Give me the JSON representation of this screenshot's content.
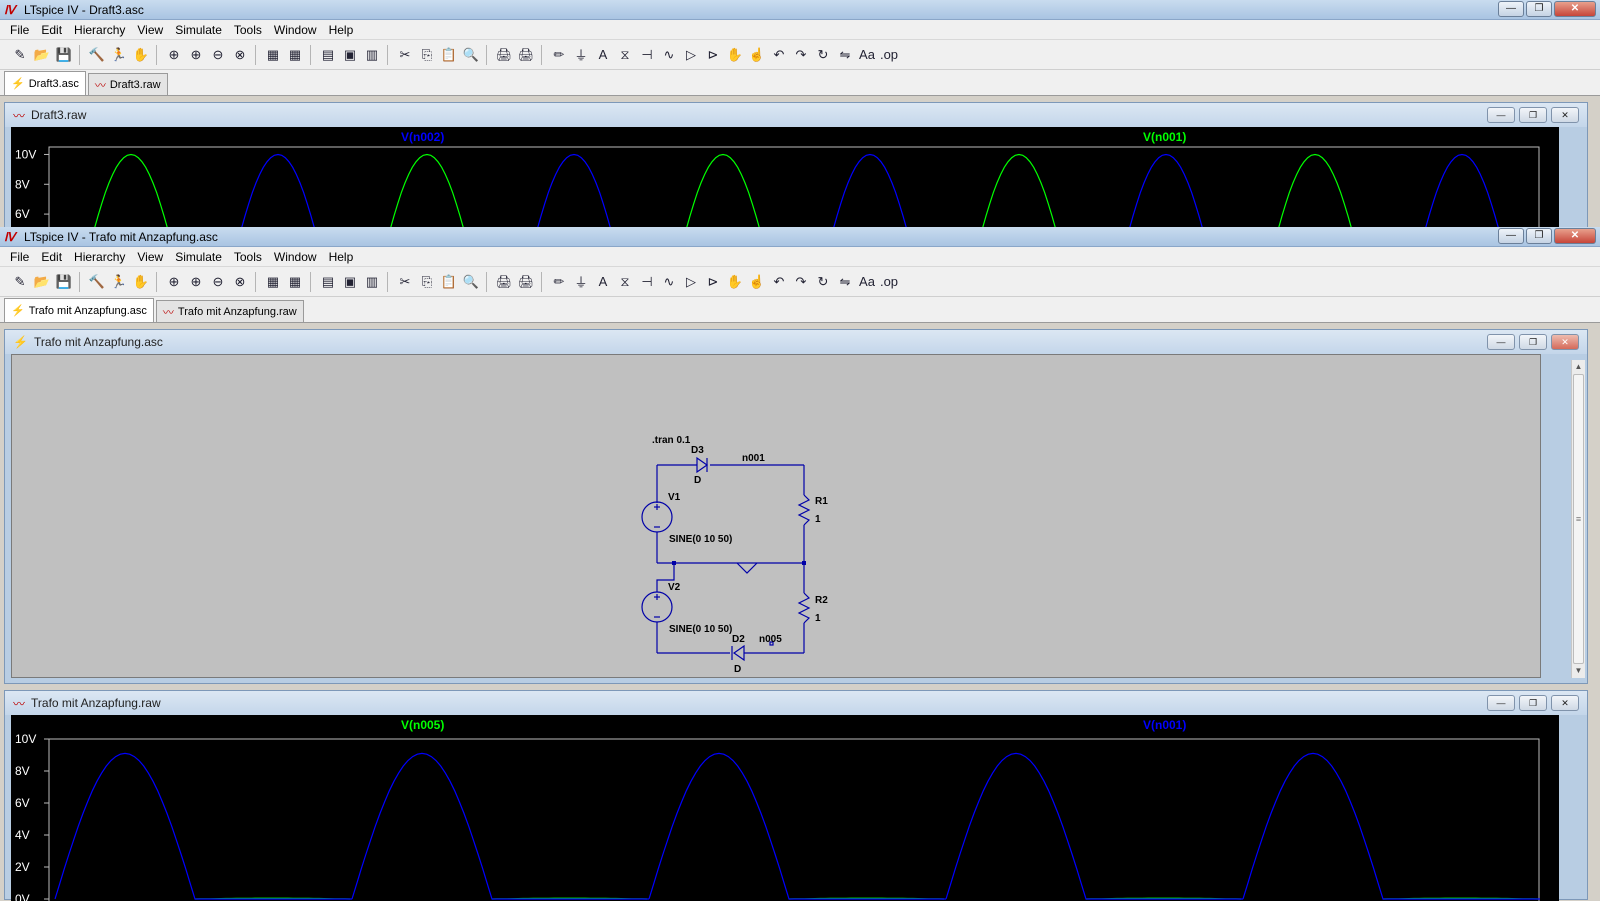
{
  "app1": {
    "title": "LTspice IV - Draft3.asc",
    "menu": [
      "File",
      "Edit",
      "Hierarchy",
      "View",
      "Simulate",
      "Tools",
      "Window",
      "Help"
    ],
    "tabs": [
      {
        "label": "Draft3.asc",
        "icon": "schematic-icon",
        "active": true
      },
      {
        "label": "Draft3.raw",
        "icon": "waveform-icon",
        "active": false
      }
    ],
    "plot_window": {
      "title": "Draft3.raw",
      "trace_labels": [
        {
          "label": "V(n002)",
          "color": "#0000ff"
        },
        {
          "label": "V(n001)",
          "color": "#00ff00"
        }
      ],
      "y_ticks": [
        "10V",
        "8V",
        "6V"
      ]
    }
  },
  "app2": {
    "title": "LTspice IV - Trafo mit Anzapfung.asc",
    "menu": [
      "File",
      "Edit",
      "Hierarchy",
      "View",
      "Simulate",
      "Tools",
      "Window",
      "Help"
    ],
    "tabs": [
      {
        "label": "Trafo mit Anzapfung.asc",
        "icon": "schematic-icon",
        "active": true
      },
      {
        "label": "Trafo mit Anzapfung.raw",
        "icon": "waveform-icon",
        "active": false
      }
    ],
    "schematic_window": {
      "title": "Trafo mit Anzapfung.asc",
      "directive": ".tran 0.1",
      "labels": {
        "d3": "D3",
        "d3_model": "D",
        "n001": "n001",
        "v1": "V1",
        "v1_value": "SINE(0 10 50)",
        "r1": "R1",
        "r1_value": "1",
        "v2": "V2",
        "v2_value": "SINE(0 10 50)",
        "r2": "R2",
        "r2_value": "1",
        "d2": "D2",
        "d2_model": "D",
        "n005": "n005"
      }
    },
    "plot_window": {
      "title": "Trafo mit Anzapfung.raw",
      "trace_labels": [
        {
          "label": "V(n005)",
          "color": "#00ff00"
        },
        {
          "label": "V(n001)",
          "color": "#0000ff"
        }
      ],
      "y_ticks": [
        "10V",
        "8V",
        "6V",
        "4V",
        "2V",
        "0V"
      ]
    }
  },
  "window_controls": {
    "minimize": "—",
    "maximize": "❐",
    "close": "✕"
  },
  "toolbar_icons": [
    "new-schematic-icon",
    "open-icon",
    "save-icon",
    "control-panel-icon",
    "run-icon",
    "halt-icon",
    "zoom-in-icon",
    "zoom-area-icon",
    "zoom-out-icon",
    "zoom-cancel-icon",
    "autorange-icon",
    "grid-icon",
    "tile-horizontal-icon",
    "cascade-icon",
    "tile-vertical-icon",
    "cut-icon",
    "copy-icon",
    "paste-icon",
    "find-icon",
    "print-setup-icon",
    "print-icon",
    "wire-icon",
    "ground-icon",
    "label-net-icon",
    "resistor-icon",
    "capacitor-icon",
    "inductor-icon",
    "diode-icon",
    "component-icon",
    "move-icon",
    "drag-icon",
    "undo-icon",
    "redo-icon",
    "rotate-icon",
    "mirror-icon",
    "text-icon",
    "spice-directive-icon"
  ],
  "chart_data": [
    {
      "type": "line",
      "title": "Draft3.raw",
      "ylim": [
        5,
        10.5
      ],
      "y_ticks": [
        "10V",
        "8V",
        "6V"
      ],
      "series": [
        {
          "name": "V(n001)",
          "color": "#00ff00",
          "shape": "half-wave rectified sine",
          "peak": 10
        },
        {
          "name": "V(n002)",
          "color": "#0000ff",
          "shape": "half-wave rectified sine",
          "peak": 10
        }
      ]
    },
    {
      "type": "line",
      "title": "Trafo mit Anzapfung.raw",
      "ylim": [
        0,
        10
      ],
      "y_ticks": [
        "10V",
        "8V",
        "6V",
        "4V",
        "2V",
        "0V"
      ],
      "series": [
        {
          "name": "V(n001)",
          "color": "#0000ff",
          "shape": "full-wave rectified sine",
          "peak": 9.1
        },
        {
          "name": "V(n005)",
          "color": "#00ff00",
          "shape": "near zero",
          "peak": 0
        }
      ]
    }
  ]
}
